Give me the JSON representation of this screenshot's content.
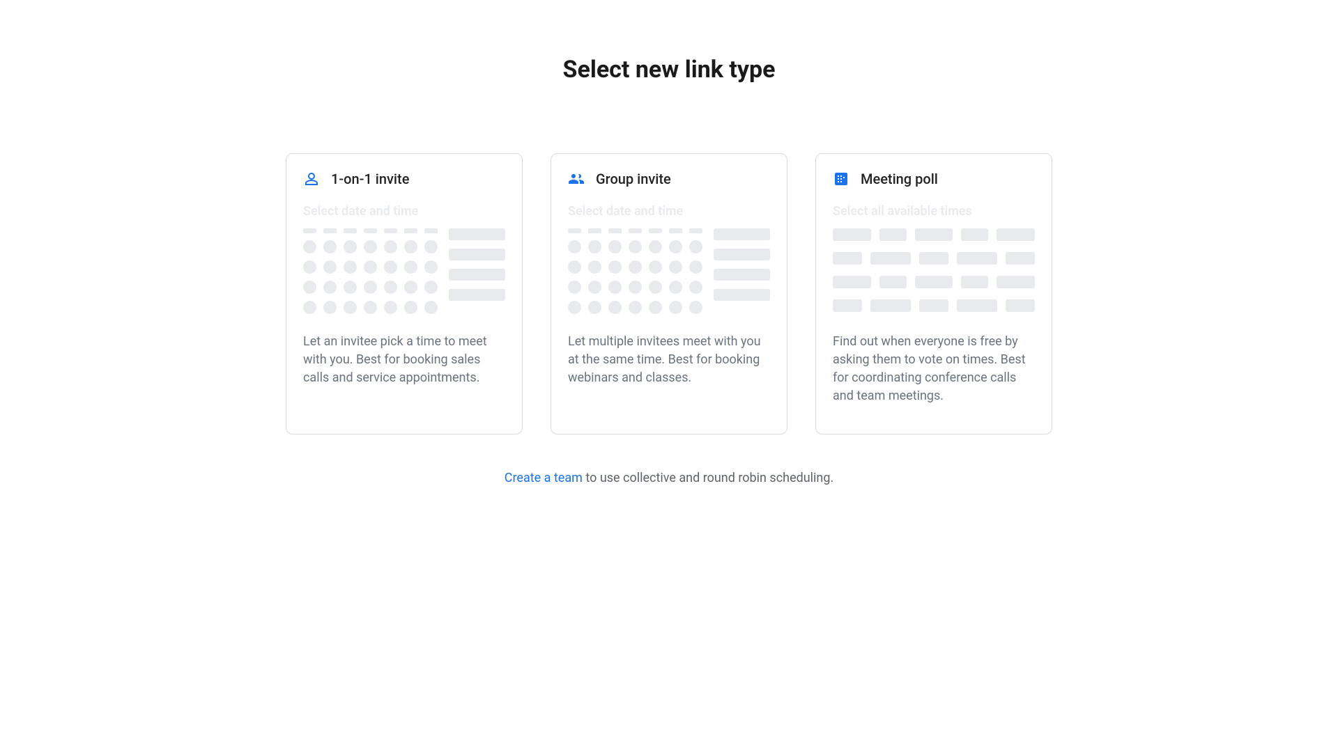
{
  "page": {
    "title": "Select new link type"
  },
  "cards": {
    "one_on_one": {
      "title": "1-on-1 invite",
      "preview_label": "Select date and time",
      "description": "Let an invitee pick a time to meet with you. Best for booking sales calls and service appointments."
    },
    "group": {
      "title": "Group invite",
      "preview_label": "Select date and time",
      "description": "Let multiple invitees meet with you at the same time. Best for booking webinars and classes."
    },
    "poll": {
      "title": "Meeting poll",
      "preview_label": "Select all available times",
      "description": "Find out when everyone is free by asking them to vote on times. Best for coordinating conference calls and team meetings."
    }
  },
  "footer": {
    "link_text": "Create a team",
    "rest_text": " to use collective and round robin scheduling."
  }
}
